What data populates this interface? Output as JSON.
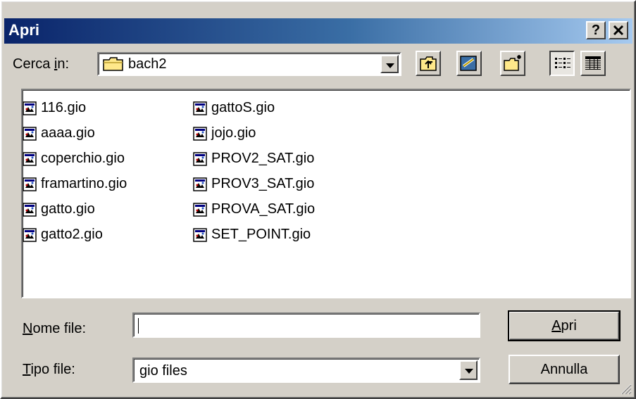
{
  "window": {
    "title": "Apri"
  },
  "titlebar_buttons": {
    "help": "?",
    "close": "✕"
  },
  "lookin": {
    "label_prefix": "Cerca ",
    "label_hotkey": "i",
    "label_suffix": "n:",
    "value": "bach2"
  },
  "toolbar": {
    "icons": [
      "up-folder-icon",
      "desktop-icon",
      "new-folder-icon",
      "list-view-icon",
      "details-view-icon"
    ],
    "pressed": "list-view-icon"
  },
  "files": {
    "column1": [
      "116.gio",
      "aaaa.gio",
      "coperchio.gio",
      "framartino.gio",
      "gatto.gio",
      "gatto2.gio"
    ],
    "column2": [
      "gattoS.gio",
      "jojo.gio",
      "PROV2_SAT.gio",
      "PROV3_SAT.gio",
      "PROVA_SAT.gio",
      "SET_POINT.gio"
    ]
  },
  "filename": {
    "label_hotkey": "N",
    "label_rest": "ome file:",
    "value": ""
  },
  "filetype": {
    "label_hotkey": "T",
    "label_rest": "ipo file:",
    "value": "gio files"
  },
  "buttons": {
    "open_hotkey": "A",
    "open_rest": "pri",
    "cancel": "Annulla"
  },
  "colors": {
    "face": "#d4d0c8",
    "title_start": "#0a246a",
    "title_end": "#a6caf0"
  }
}
